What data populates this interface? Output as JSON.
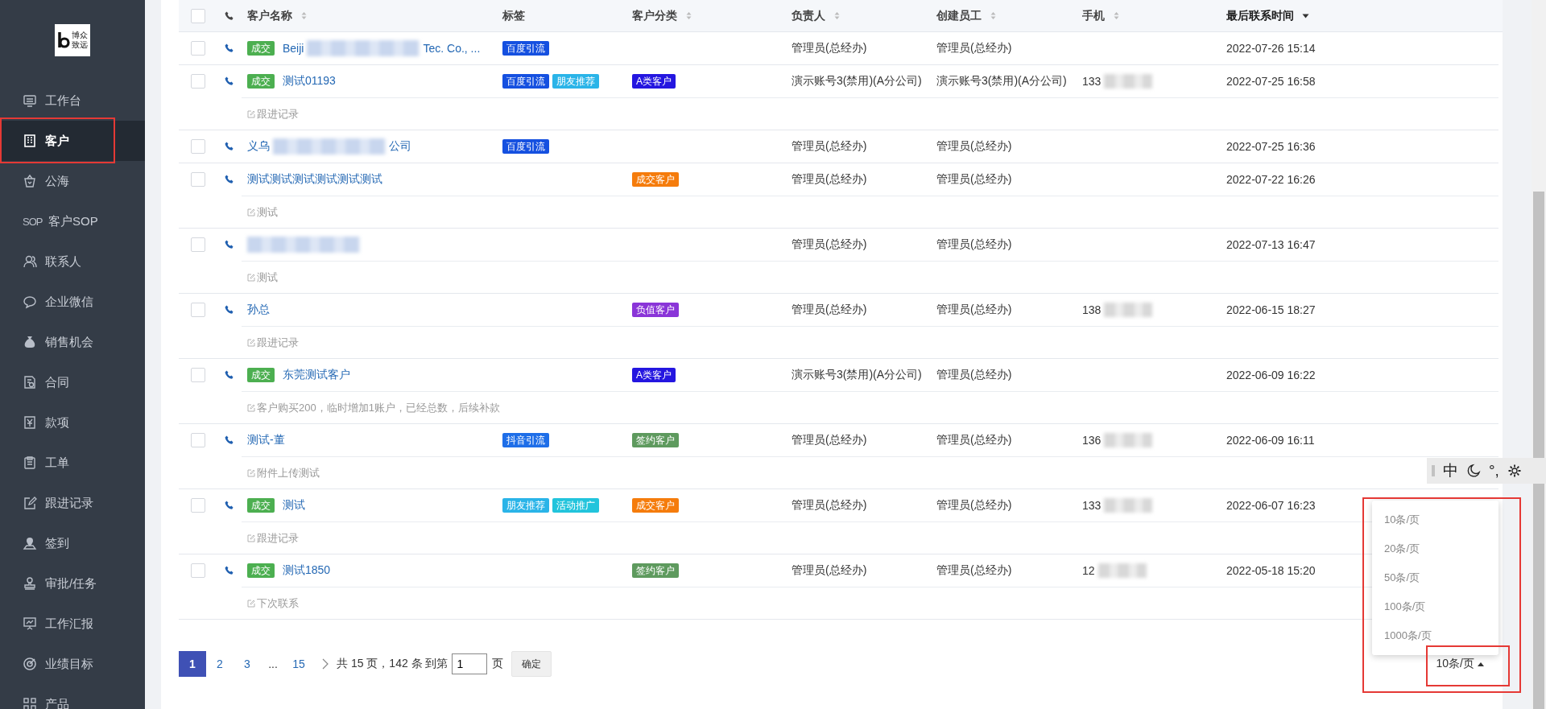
{
  "sidebar": {
    "logo": {
      "line1": "博众",
      "line2": "致远"
    },
    "items": [
      {
        "label": "工作台",
        "selected": false
      },
      {
        "label": "客户",
        "selected": true
      },
      {
        "label": "公海",
        "selected": false
      },
      {
        "label": "客户SOP",
        "icon_text": "SOP",
        "selected": false
      },
      {
        "label": "联系人",
        "selected": false
      },
      {
        "label": "企业微信",
        "selected": false
      },
      {
        "label": "销售机会",
        "selected": false
      },
      {
        "label": "合同",
        "selected": false
      },
      {
        "label": "款项",
        "selected": false
      },
      {
        "label": "工单",
        "selected": false
      },
      {
        "label": "跟进记录",
        "selected": false
      },
      {
        "label": "签到",
        "selected": false
      },
      {
        "label": "审批/任务",
        "selected": false
      },
      {
        "label": "工作汇报",
        "selected": false
      },
      {
        "label": "业绩目标",
        "selected": false
      },
      {
        "label": "产品",
        "selected": false
      }
    ]
  },
  "table": {
    "header_checked": false,
    "columns": [
      {
        "label": "客户名称",
        "sorted": false
      },
      {
        "label": "标签"
      },
      {
        "label": "客户分类",
        "sorted": false
      },
      {
        "label": "负责人",
        "sorted": false
      },
      {
        "label": "创建员工",
        "sorted": false
      },
      {
        "label": "手机",
        "sorted": false
      },
      {
        "label": "最后联系时间",
        "sorted": true
      }
    ],
    "rows": [
      {
        "checked": false,
        "status": {
          "label": "成交",
          "color": "#4caf50"
        },
        "name": "Beiji",
        "redacted": true,
        "name_tail": "Tec. Co., ...",
        "tags": [
          {
            "label": "百度引流",
            "color": "#1550e0"
          }
        ],
        "owner": "管理员(总经办)",
        "creator": "管理员(总经办)",
        "last_contact": "2022-07-26 15:14"
      },
      {
        "checked": false,
        "status": {
          "label": "成交",
          "color": "#4caf50"
        },
        "name": "测试01193",
        "tags": [
          {
            "label": "百度引流",
            "color": "#1550e0"
          },
          {
            "label": "朋友推荐",
            "color": "#2ab4e8"
          }
        ],
        "category": {
          "label": "A类客户",
          "color": "#2416e0"
        },
        "owner": "演示账号3(禁用)(A分公司)",
        "creator": "演示账号3(禁用)(A分公司)",
        "mobile": "133",
        "mobile_redacted": true,
        "last_contact": "2022-07-25 16:58",
        "note": "跟进记录"
      },
      {
        "checked": false,
        "name": "义乌",
        "redacted": true,
        "name_tail": "公司",
        "tags": [
          {
            "label": "百度引流",
            "color": "#1550e0"
          }
        ],
        "owner": "管理员(总经办)",
        "creator": "管理员(总经办)",
        "last_contact": "2022-07-25 16:36"
      },
      {
        "checked": false,
        "name": "测试测试测试测试测试测试",
        "tags": [],
        "category": {
          "label": "成交客户",
          "color": "#f57c0c"
        },
        "owner": "管理员(总经办)",
        "creator": "管理员(总经办)",
        "last_contact": "2022-07-22 16:26",
        "note": "测试"
      },
      {
        "checked": false,
        "redacted": true,
        "tags": [],
        "owner": "管理员(总经办)",
        "creator": "管理员(总经办)",
        "last_contact": "2022-07-13 16:47",
        "note": "测试"
      },
      {
        "checked": false,
        "name": "孙总",
        "tags": [],
        "category": {
          "label": "负值客户",
          "color": "#8a35d8"
        },
        "owner": "管理员(总经办)",
        "creator": "管理员(总经办)",
        "mobile": "138",
        "mobile_redacted": true,
        "last_contact": "2022-06-15 18:27",
        "note": "跟进记录"
      },
      {
        "checked": false,
        "status": {
          "label": "成交",
          "color": "#4caf50"
        },
        "name": "东莞测试客户",
        "tags": [],
        "category": {
          "label": "A类客户",
          "color": "#2416e0"
        },
        "owner": "演示账号3(禁用)(A分公司)",
        "creator": "管理员(总经办)",
        "last_contact": "2022-06-09 16:22",
        "note": "客户购买200，临时增加1账户，已经总数，后续补款"
      },
      {
        "checked": false,
        "name": "测试-董",
        "tags": [
          {
            "label": "抖音引流",
            "color": "#1e6ee8"
          }
        ],
        "category": {
          "label": "签约客户",
          "color": "#5e9a5e"
        },
        "owner": "管理员(总经办)",
        "creator": "管理员(总经办)",
        "mobile": "136",
        "mobile_redacted": true,
        "last_contact": "2022-06-09 16:11",
        "note": "附件上传测试"
      },
      {
        "checked": false,
        "status": {
          "label": "成交",
          "color": "#4caf50"
        },
        "name": "测试",
        "tags": [
          {
            "label": "朋友推荐",
            "color": "#2ab4e8"
          },
          {
            "label": "活动推广",
            "color": "#22c4dc"
          }
        ],
        "category": {
          "label": "成交客户",
          "color": "#f57c0c"
        },
        "owner": "管理员(总经办)",
        "creator": "管理员(总经办)",
        "mobile": "133",
        "mobile_redacted": true,
        "last_contact": "2022-06-07 16:23",
        "note": "跟进记录"
      },
      {
        "checked": false,
        "status": {
          "label": "成交",
          "color": "#4caf50"
        },
        "name": "测试1850",
        "tags": [],
        "category": {
          "label": "签约客户",
          "color": "#5e9a5e"
        },
        "owner": "管理员(总经办)",
        "creator": "管理员(总经办)",
        "mobile": "12",
        "mobile_redacted": true,
        "last_contact": "2022-05-18 15:20",
        "note": "下次联系"
      }
    ]
  },
  "pagination": {
    "pages": [
      {
        "label": "1",
        "kind": "page",
        "selected": true
      },
      {
        "label": "2",
        "kind": "page",
        "selected": false
      },
      {
        "label": "3",
        "kind": "page",
        "selected": false
      },
      {
        "label": "...",
        "kind": "ellipsis"
      },
      {
        "label": "15",
        "kind": "page",
        "selected": false
      }
    ],
    "summary": "共 15 页，142 条 到第",
    "jump_value": "1",
    "jump_suffix": "页",
    "confirm": "确定",
    "page_size": "10条/页",
    "page_size_open": true,
    "page_size_options": [
      {
        "label": "10条/页",
        "selected": false
      },
      {
        "label": "20条/页",
        "selected": false
      },
      {
        "label": "50条/页",
        "selected": false
      },
      {
        "label": "100条/页",
        "selected": false
      },
      {
        "label": "1000条/页",
        "selected": false
      }
    ]
  },
  "ime_toolbar": {
    "mode": "中",
    "punct": "°,"
  }
}
